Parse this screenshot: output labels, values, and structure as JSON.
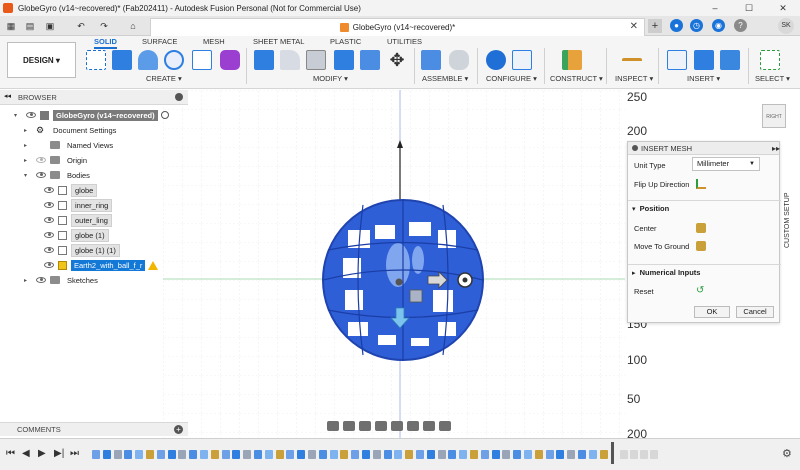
{
  "window": {
    "title": "GlobeGyro (v14~recovered)* (Fab202411) - Autodesk Fusion Personal (Not for Commercial Use)",
    "controls": [
      "–",
      "☐",
      "✕"
    ]
  },
  "tabbar": {
    "doc_tab_title": "GlobeGyro (v14~recovered)*",
    "close": "✕",
    "plus": "+",
    "avatar_initials": "SK"
  },
  "ribbon": {
    "workspace_label": "DESIGN ▾",
    "tabs": [
      "SOLID",
      "SURFACE",
      "MESH",
      "SHEET METAL",
      "PLASTIC",
      "UTILITIES"
    ],
    "groups": [
      "CREATE ▾",
      "MODIFY ▾",
      "ASSEMBLE ▾",
      "CONFIGURE ▾",
      "CONSTRUCT ▾",
      "INSPECT ▾",
      "INSERT ▾",
      "SELECT ▾"
    ]
  },
  "browser": {
    "title": "BROWSER",
    "root": "GlobeGyro (v14~recovered)",
    "items": [
      {
        "label": "Document Settings",
        "type": "settings"
      },
      {
        "label": "Named Views",
        "type": "folder"
      },
      {
        "label": "Origin",
        "type": "folder"
      },
      {
        "label": "Bodies",
        "type": "folder"
      }
    ],
    "bodies": [
      "globe",
      "inner_ring",
      "outer_ling",
      "globe (1)",
      "globe (1) (1)"
    ],
    "selected_body": "Earth2_with_ball_f_r",
    "sketches": "Sketches"
  },
  "comments": {
    "title": "COMMENTS"
  },
  "ruler": {
    "ticks": [
      "250",
      "200",
      "150",
      "100",
      "50",
      "150",
      "100",
      "200"
    ]
  },
  "navcube": {
    "face": "RIGHT"
  },
  "insert_mesh": {
    "title": "INSERT MESH",
    "unit_type_label": "Unit Type",
    "unit_type_value": "Millimeter",
    "flip_up_label": "Flip Up Direction",
    "position_section": "Position",
    "center_label": "Center",
    "move_to_ground_label": "Move To Ground",
    "numerical_inputs_section": "Numerical Inputs",
    "reset_label": "Reset",
    "ok": "OK",
    "cancel": "Cancel"
  },
  "side_panel": {
    "custom_setup": "CUSTOM SETUP"
  },
  "colors": {
    "accent": "#1378d6",
    "mesh_blue": "#2f5fd6",
    "warning": "#f2b600"
  }
}
